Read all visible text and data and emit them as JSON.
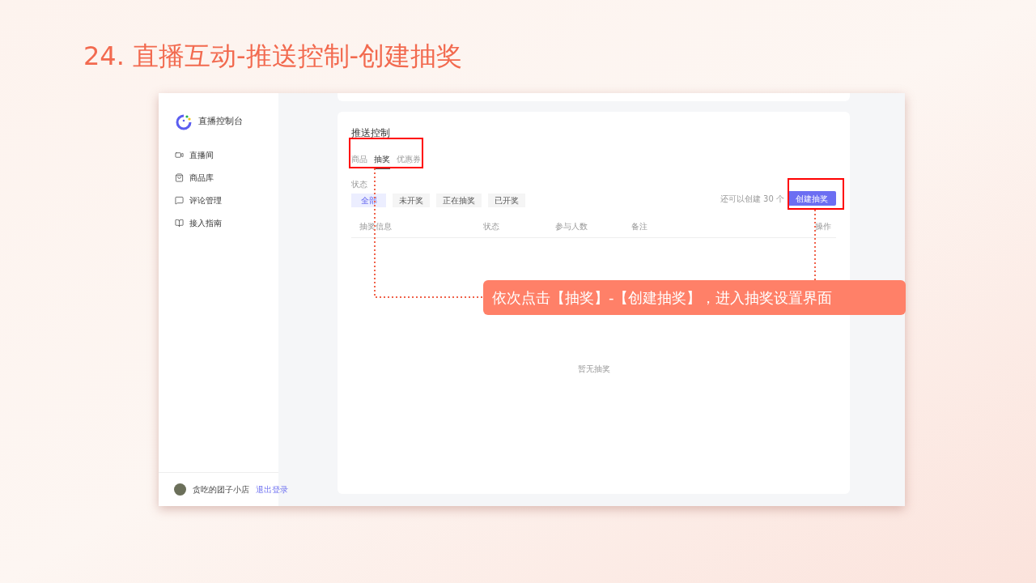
{
  "slide_title": "24. 直播互动-推送控制-创建抽奖",
  "sidebar": {
    "brand": "直播控制台",
    "items": [
      {
        "label": "直播间",
        "kind": "video"
      },
      {
        "label": "商品库",
        "kind": "bag"
      },
      {
        "label": "评论管理",
        "kind": "comment"
      },
      {
        "label": "接入指南",
        "kind": "book"
      }
    ],
    "user": {
      "name": "贪吃的团子小店",
      "logout": "退出登录"
    }
  },
  "panel": {
    "title": "推送控制",
    "tabs": [
      {
        "label": "商品",
        "selected": false
      },
      {
        "label": "抽奖",
        "selected": true
      },
      {
        "label": "优惠券",
        "selected": false
      }
    ],
    "status_label": "状态",
    "filters": [
      {
        "label": "全部",
        "selected": true
      },
      {
        "label": "未开奖",
        "selected": false
      },
      {
        "label": "正在抽奖",
        "selected": false
      },
      {
        "label": "已开奖",
        "selected": false
      }
    ],
    "quota": "还可以创建 30 个",
    "create_button": "创建抽奖",
    "columns": [
      "抽奖信息",
      "状态",
      "参与人数",
      "备注",
      "操作"
    ],
    "empty": "暂无抽奖"
  },
  "callout": "依次点击【抽奖】-【创建抽奖】，进入抽奖设置界面"
}
